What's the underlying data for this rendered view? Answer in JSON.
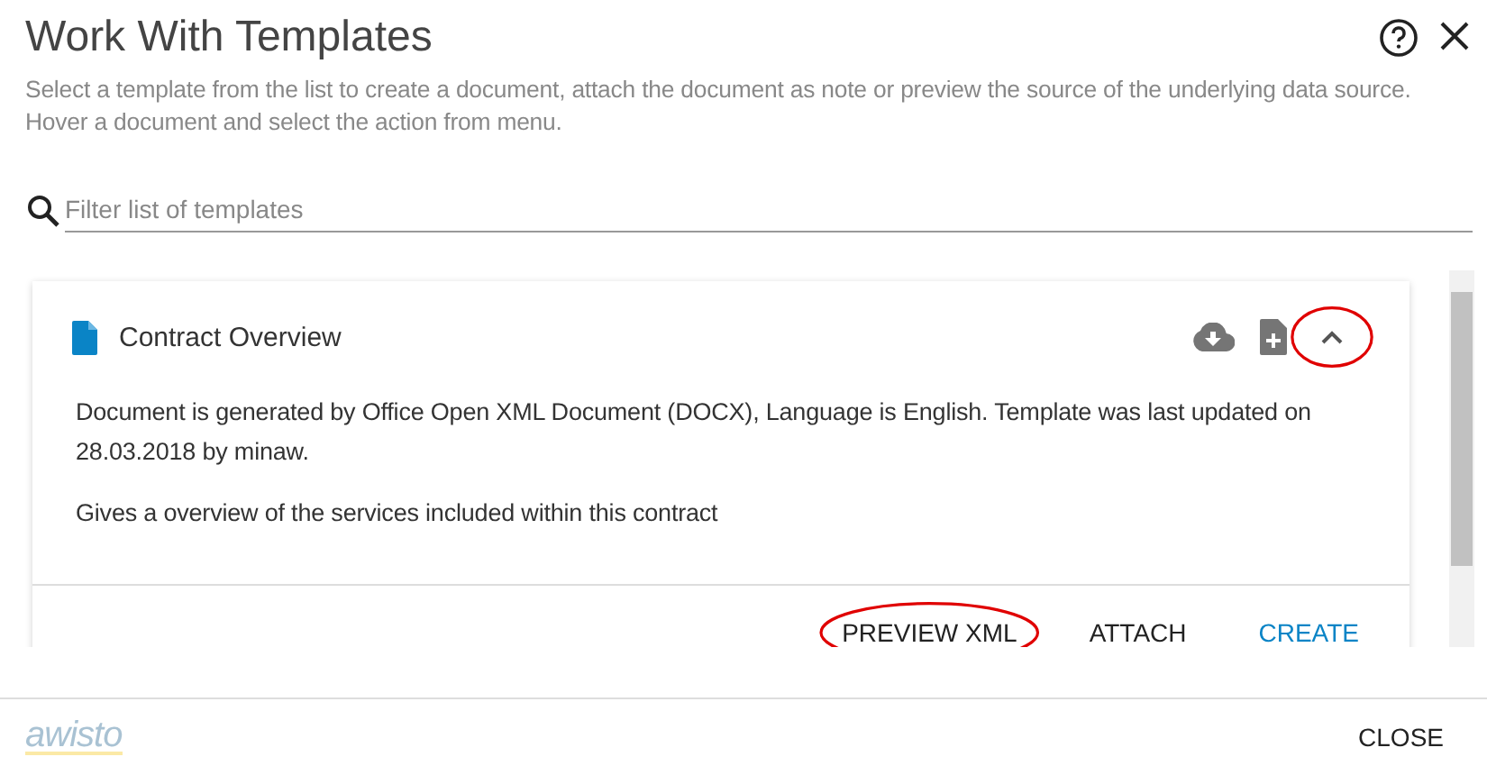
{
  "dialog": {
    "title": "Work With Templates",
    "description": "Select a template from the list to create a document, attach the document as note or preview the source of the underlying data source. Hover a document and select the action from menu."
  },
  "filter": {
    "placeholder": "Filter list of templates"
  },
  "templates": [
    {
      "name": "Contract Overview",
      "expanded": true,
      "toggle_circled": true,
      "details": [
        "Document is generated by Office Open XML Document (DOCX), Language is English. Template was last updated on 28.03.2018 by minaw.",
        "Gives a overview of the services included within this contract"
      ],
      "actions": [
        {
          "label": "PREVIEW XML",
          "kind": "plain",
          "circled": true
        },
        {
          "label": "ATTACH",
          "kind": "plain",
          "circled": false
        },
        {
          "label": "CREATE",
          "kind": "primary",
          "circled": false
        }
      ]
    }
  ],
  "footer": {
    "logo": "awisto",
    "close": "CLOSE"
  }
}
